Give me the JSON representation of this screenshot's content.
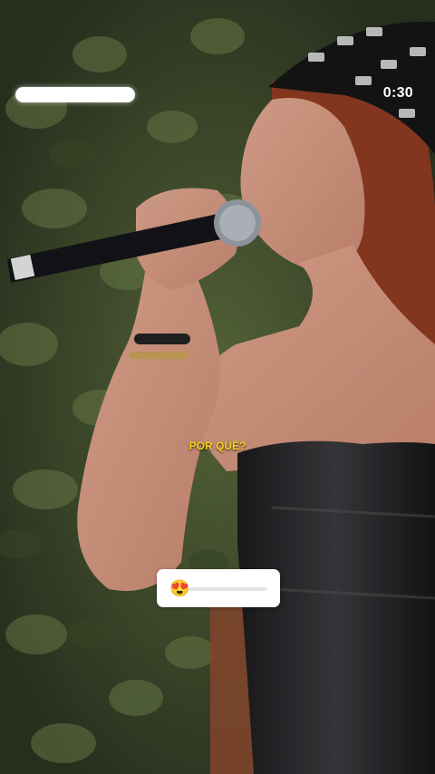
{
  "story": {
    "timer": "0:30",
    "caption": "POR QUÊ?",
    "emoji_slider": {
      "emoji": "😍",
      "emoji_icon": "heart-eyes-emoji-icon",
      "value_fraction": 0.0
    },
    "colors": {
      "caption": "#f5d21a",
      "slider_track": "#e4e4e4",
      "overlay_bg": "#ffffff"
    }
  }
}
